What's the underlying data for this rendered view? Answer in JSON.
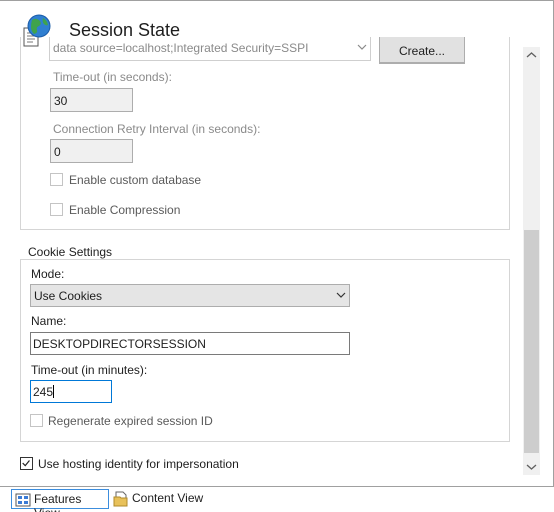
{
  "header": {
    "title": "Session State",
    "icon": "globe-document-icon"
  },
  "sql_settings": {
    "connection_string": "data source=localhost;Integrated Security=SSPI",
    "create_button": "Create...",
    "timeout_label": "Time-out (in seconds):",
    "timeout_value": "30",
    "retry_label": "Connection Retry Interval (in seconds):",
    "retry_value": "0",
    "custom_db_label": "Enable custom database",
    "compression_label": "Enable Compression"
  },
  "cookie_settings": {
    "title": "Cookie Settings",
    "mode_label": "Mode:",
    "mode_value": "Use Cookies",
    "name_label": "Name:",
    "name_value": "DESKTOPDIRECTORSESSION",
    "timeout_label": "Time-out (in minutes):",
    "timeout_value": "245",
    "regenerate_label": "Regenerate expired session ID"
  },
  "impersonation": {
    "label": "Use hosting identity for impersonation",
    "checked": true
  },
  "bottom_bar": {
    "features_view": "Features View",
    "content_view": "Content View"
  },
  "colors": {
    "accent": "#0078d7",
    "disabled_text": "#8a8a8a"
  }
}
